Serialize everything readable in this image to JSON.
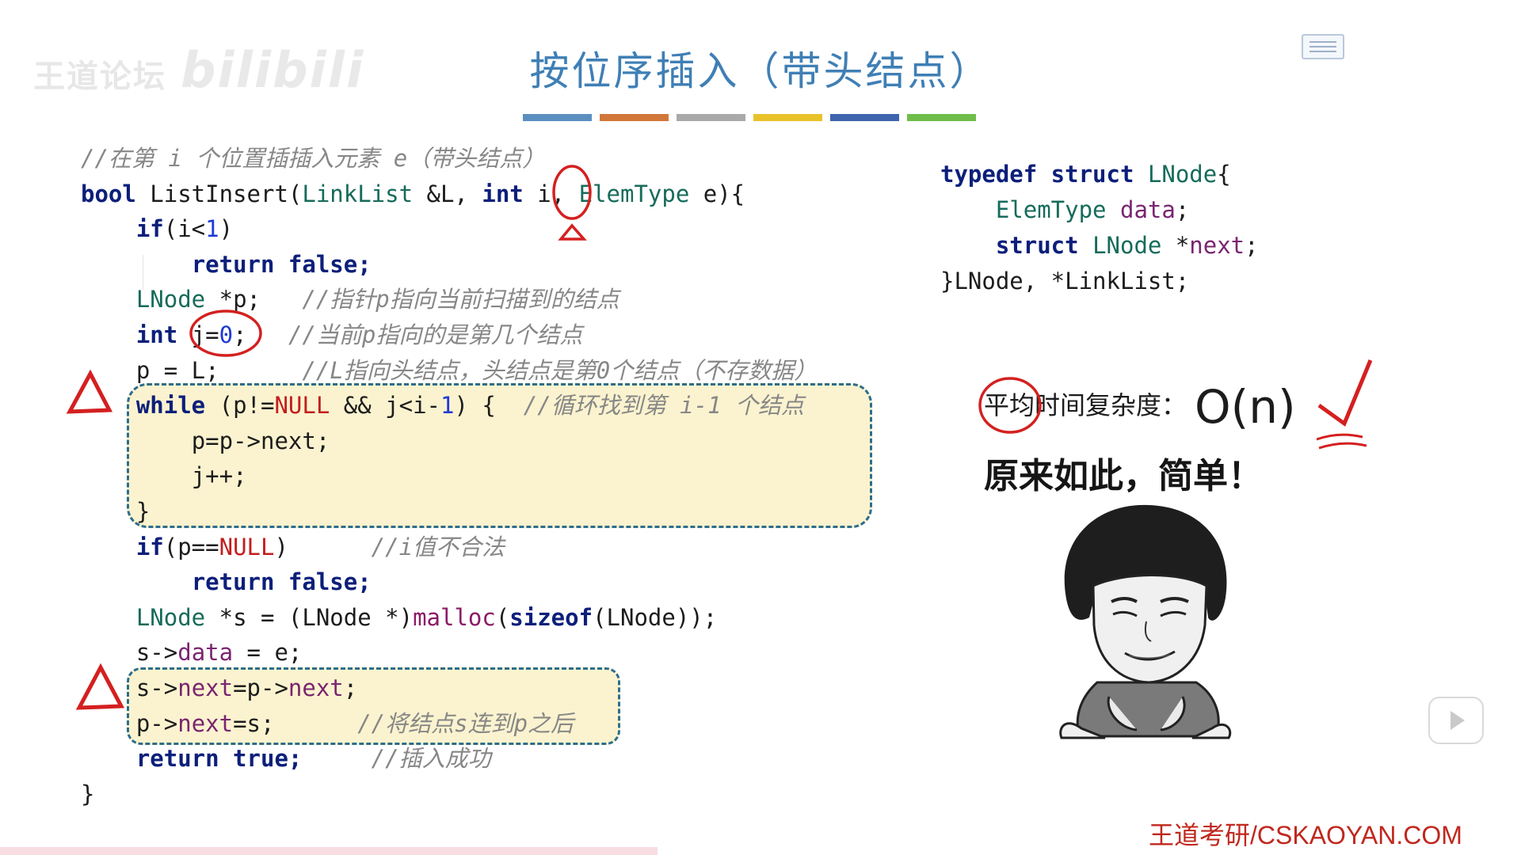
{
  "title": "按位序插入（带头结点）",
  "watermark": {
    "left": "王道论坛",
    "right": "bilibili"
  },
  "color_bars": [
    "#5b8fc0",
    "#d2773a",
    "#a9a9a9",
    "#e9c22a",
    "#3f64ad",
    "#6fbd4a"
  ],
  "code": {
    "comment_header": "//在第 i 个位置插插入元素 e（带头结点）",
    "sig_bool": "bool",
    "sig_name": " ListInsert(",
    "sig_type": "LinkList",
    "sig_ref": " &L, ",
    "sig_int": "int",
    "sig_i": " i,",
    "sig_etype": " ElemType",
    "sig_tail": " e){",
    "if_kw": "if",
    "if_cond1": "(i<",
    "if_num": "1",
    "if_cond2": ")",
    "ret_false": "return false;",
    "p_type": "LNode",
    "p_decl": " *p;   ",
    "p_cm": "//指针p指向当前扫描到的结点",
    "j_int": "int",
    "j_var": " j=",
    "j_num": "0",
    "j_semi": ";   ",
    "j_cm": "//当前p指向的是第几个结点",
    "p_assign": "p = L;      ",
    "p_assign_cm": "//L指向头结点，头结点是第0个结点（不存数据）",
    "while_kw": "while",
    "while_a": " (p!=",
    "while_null": "NULL",
    "while_b": " && j<i-",
    "while_num": "1",
    "while_c": ") {  ",
    "while_cm": "//循环找到第 i-1 个结点",
    "loop1": "p=p->next;",
    "loop2": "j++;",
    "loop_close": "}",
    "if2_kw": "if",
    "if2_a": "(p==",
    "if2_null": "NULL",
    "if2_b": ")      ",
    "if2_cm": "//i值不合法",
    "ret_false2": "return false;",
    "s_type": "LNode",
    "s_a": " *s = (LNode *)",
    "s_malloc": "malloc",
    "s_b": "(",
    "s_sizeof": "sizeof",
    "s_c": "(LNode));",
    "sd_a": "s->",
    "sd_field": "data",
    "sd_b": " = e;",
    "sn_a": "s->",
    "sn_field": "next",
    "sn_b": "=p->",
    "sn_field2": "next",
    "sn_c": ";",
    "pn_a": "p->",
    "pn_field": "next",
    "pn_b": "=s;      ",
    "pn_cm": "//将结点s连到p之后",
    "ret_true_kw": "return true;",
    "ret_true_pad": "     ",
    "ret_true_cm": "//插入成功",
    "close": "}"
  },
  "struct": {
    "l1_kw": "typedef struct",
    "l1_name": " LNode",
    "l1_brace": "{",
    "l2_type": "ElemType",
    "l2_field": " data",
    "l2_semi": ";",
    "l3_kw": "struct",
    "l3_type": " LNode",
    "l3_ptr": " *",
    "l3_field": "next",
    "l3_semi": ";",
    "l4": "}LNode, *LinkList;"
  },
  "complexity": {
    "label": "平均时间复杂度：",
    "value": "O(n)"
  },
  "exclaim": "原来如此，简单！",
  "footer": "王道考研/CSKAOYAN.COM"
}
